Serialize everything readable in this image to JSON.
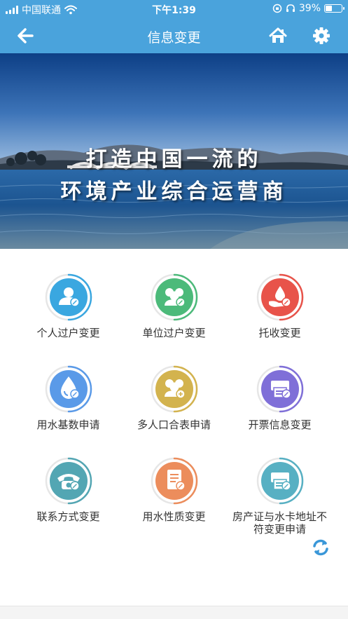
{
  "status_bar": {
    "carrier": "中国联通",
    "time": "下午1:39",
    "battery": "39%",
    "battery_level": 0.39
  },
  "header": {
    "title": "信息变更",
    "back_icon": "back-arrow-icon",
    "home_icon": "home-icon",
    "settings_icon": "gear-icon",
    "color": "#4aa3dc"
  },
  "banner": {
    "line1": "打造中国一流的",
    "line2": "环境产业综合运营商"
  },
  "menu": [
    {
      "label": "个人过户变更",
      "icon": "person-icon",
      "color": "#3aa7e0"
    },
    {
      "label": "单位过户变更",
      "icon": "group-icon",
      "color": "#4cba7a"
    },
    {
      "label": "托收变更",
      "icon": "hand-drop-icon",
      "color": "#e8534a"
    },
    {
      "label": "用水基数申请",
      "icon": "water-drop-icon",
      "color": "#5a9ae8"
    },
    {
      "label": "多人口合表申请",
      "icon": "group-add-icon",
      "color": "#d3b34e"
    },
    {
      "label": "开票信息变更",
      "icon": "printer-icon",
      "color": "#7f6fd8"
    },
    {
      "label": "联系方式变更",
      "icon": "telephone-icon",
      "color": "#53a6b3"
    },
    {
      "label": "用水性质变更",
      "icon": "document-icon",
      "color": "#ec8d5c"
    },
    {
      "label": "房产证与水卡地址不符变更申请",
      "icon": "printer-icon",
      "color": "#57b0c3"
    }
  ],
  "refresh_icon": "refresh-icon"
}
